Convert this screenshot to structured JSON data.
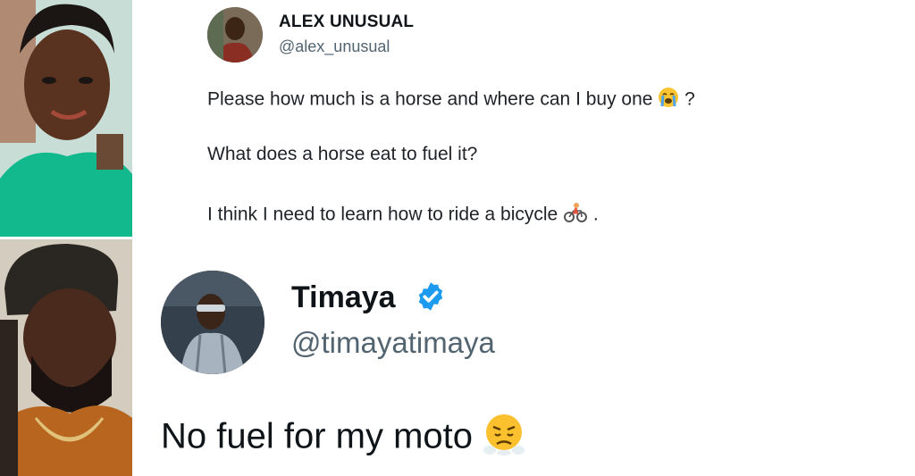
{
  "tweet1": {
    "display_name": "ALEX UNUSUAL",
    "handle": "@alex_unusual",
    "lines": [
      {
        "text": "Please how much is a horse and where can I buy one",
        "suffix": "?",
        "emoji": "crying-face-icon"
      },
      {
        "text": "What does a horse eat to fuel it?",
        "suffix": "",
        "emoji": ""
      },
      {
        "text": "I think I need to learn how to ride a bicycle",
        "suffix": ".",
        "emoji": "bicyclist-icon"
      }
    ]
  },
  "tweet2": {
    "display_name": "Timaya",
    "handle": "@timayatimaya",
    "text": "No fuel for my moto",
    "emoji": "angry-steam-face-icon"
  },
  "colors": {
    "verified_blue": "#1d9bf0",
    "handle_gray": "#536471",
    "text_dark": "#0f1419"
  }
}
